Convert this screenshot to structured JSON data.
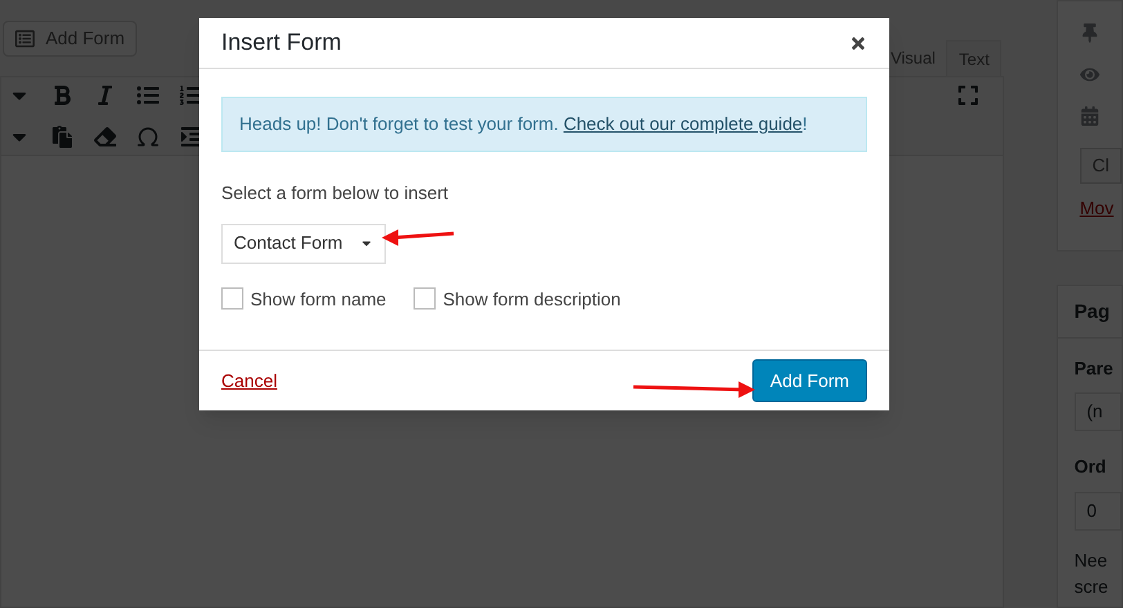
{
  "editor": {
    "add_form_button": "Add Form",
    "tabs": [
      {
        "label": "Visual",
        "selected": false
      },
      {
        "label": "Text",
        "selected": true
      }
    ]
  },
  "sidebar": {
    "publish_button": "Cl",
    "publish_link": "Mov",
    "page_attributes": {
      "title": "Pag",
      "parent_label": "Pare",
      "parent_value": "(n",
      "order_label": "Ord",
      "order_value": "0",
      "help_lines": [
        "Nee",
        "scre"
      ]
    }
  },
  "modal": {
    "title": "Insert Form",
    "notice": {
      "text": "Heads up! Don't forget to test your form. ",
      "link": "Check out our complete guide",
      "suffix": "!"
    },
    "select_label": "Select a form below to insert",
    "select_value": "Contact Form",
    "checkboxes": [
      {
        "label": "Show form name",
        "checked": false
      },
      {
        "label": "Show form description",
        "checked": false
      }
    ],
    "cancel": "Cancel",
    "submit": "Add Form"
  }
}
